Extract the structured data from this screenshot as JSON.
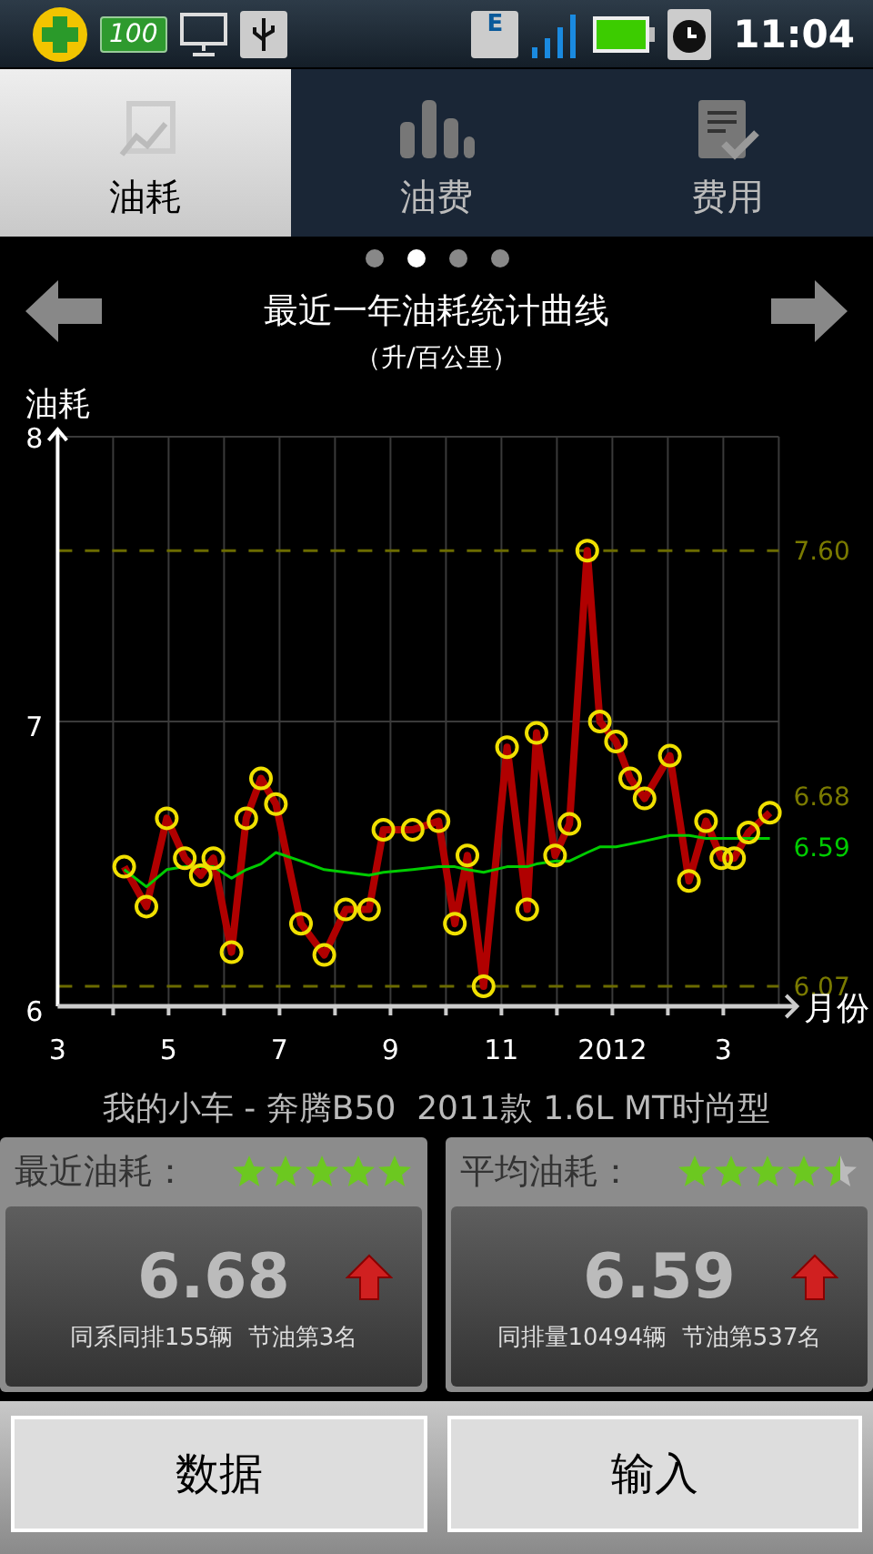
{
  "status_bar": {
    "battery_badge": "100",
    "network_type": "E",
    "time": "11:04"
  },
  "tabs": [
    {
      "label": "油耗",
      "selected": true
    },
    {
      "label": "油费",
      "selected": false
    },
    {
      "label": "费用",
      "selected": false
    }
  ],
  "page_dots": [
    {
      "selected": false
    },
    {
      "selected": true
    },
    {
      "selected": false
    },
    {
      "selected": false
    }
  ],
  "chart": {
    "title": "最近一年油耗统计曲线",
    "subtitle": "（升/百公里）",
    "chart_data": {
      "type": "line",
      "ylabel": "油耗",
      "xlabel": "月份",
      "x": [
        "2011-04-07",
        "2011-04-19",
        "2011-04-30",
        "2011-05-10",
        "2011-05-19",
        "2011-05-26",
        "2011-06-05",
        "2011-06-13",
        "2011-06-21",
        "2011-06-29",
        "2011-07-13",
        "2011-07-26",
        "2011-08-07",
        "2011-08-20",
        "2011-08-28",
        "2011-09-13",
        "2011-09-27",
        "2011-10-06",
        "2011-10-13",
        "2011-10-22",
        "2011-11-04",
        "2011-11-15",
        "2011-11-20",
        "2011-11-30",
        "2011-12-08",
        "2011-12-18",
        "2011-12-25",
        "2012-01-03",
        "2012-01-11",
        "2012-01-19",
        "2012-02-02",
        "2012-02-12",
        "2012-02-21",
        "2012-02-29",
        "2012-03-07",
        "2012-03-15",
        "2012-03-27"
      ],
      "series": [
        {
          "color": "#b00000",
          "marker": "circle",
          "values": [
            6.49,
            6.35,
            6.66,
            6.52,
            6.46,
            6.52,
            6.19,
            6.66,
            6.8,
            6.71,
            6.29,
            6.18,
            6.34,
            6.34,
            6.62,
            6.62,
            6.65,
            6.29,
            6.53,
            6.07,
            6.91,
            6.34,
            6.96,
            6.53,
            6.64,
            7.6,
            7.0,
            6.93,
            6.8,
            6.73,
            6.88,
            6.44,
            6.65,
            6.52,
            6.52,
            6.61,
            6.68
          ]
        },
        {
          "color": "#00cc00",
          "values": [
            6.48,
            6.42,
            6.48,
            6.49,
            6.49,
            6.49,
            6.45,
            6.48,
            6.5,
            6.54,
            6.51,
            6.48,
            6.47,
            6.46,
            6.47,
            6.48,
            6.49,
            6.49,
            6.48,
            6.47,
            6.49,
            6.49,
            6.5,
            6.51,
            6.51,
            6.54,
            6.56,
            6.56,
            6.57,
            6.58,
            6.6,
            6.6,
            6.59,
            6.59,
            6.59,
            6.59,
            6.59
          ]
        }
      ],
      "xlim": [
        "2011-03-01",
        "2012-04-01"
      ],
      "ylim": [
        6,
        8
      ],
      "grid": true,
      "xticks": [
        {
          "value": "2011-03-01",
          "label": "3"
        },
        {
          "value": "2011-05-01",
          "label": "5"
        },
        {
          "value": "2011-07-01",
          "label": "7"
        },
        {
          "value": "2011-09-01",
          "label": "9"
        },
        {
          "value": "2011-11-01",
          "label": "11"
        },
        {
          "value": "2012-01-01",
          "label": "2012"
        },
        {
          "value": "2012-03-01",
          "label": "3"
        }
      ],
      "yticks": [
        6,
        7,
        8
      ],
      "ref_lines": [
        {
          "axis": "y",
          "value": 7.6,
          "label": "7.60"
        },
        {
          "axis": "y",
          "value": 6.07,
          "label": "6.07"
        }
      ],
      "annotations": [
        "6.68",
        "6.59"
      ]
    }
  },
  "car_name": "我的小车 - 奔腾B50  2011款 1.6L MT时尚型",
  "cards": [
    {
      "label": "最近油耗：",
      "stars": 5,
      "value": "6.68",
      "note": "同系同排155辆  节油第3名"
    },
    {
      "label": "平均油耗：",
      "stars": 4.5,
      "value": "6.59",
      "note": "同排量10494辆  节油第537名"
    }
  ],
  "buttons": [
    "数据",
    "输入"
  ]
}
